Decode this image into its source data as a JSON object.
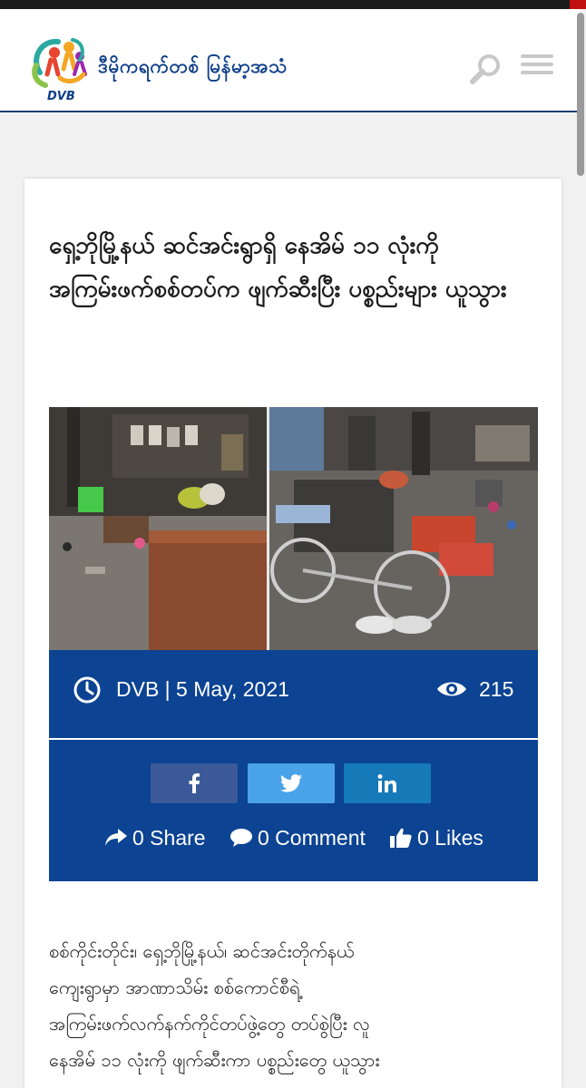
{
  "header": {
    "logo_label": "DVB",
    "site_name": "ဒီမိုကရက်တစ် မြန်မာ့အသံ"
  },
  "article": {
    "title": "ရှေ့ဘိုမြို့နယ် ဆင်အင်းရွာရှိ နေအိမ် ၁၁ လုံးကို အကြမ်းဖက်စစ်တပ်က ဖျက်ဆီးပြီး ပစ္စည်းများ ယူသွား",
    "byline": "DVB | 5 May, 2021",
    "views": "215",
    "share_label": "0 Share",
    "comment_label": "0 Comment",
    "likes_label": "0 Likes",
    "body": "စစ်ကိုင်းတိုင်း၊ ရှေ့ဘိုမြို့နယ်၊ ဆင်အင်းတိုက်နယ်\nကျေးရွာမှာ အာဏာသိမ်း စစ်ကောင်စီရဲ့\nအကြမ်းဖက်လက်နက်ကိုင်တပ်ဖွဲ့တွေ တပ်စွဲပြီး လူ\nနေအိမ် ၁၁ လုံးကို ဖျက်ဆီးကာ ပစ္စည်းတွေ ယူသွား"
  },
  "colors": {
    "meta_bg": "#0c4393",
    "facebook": "#3b5998",
    "twitter": "#4aa3e8",
    "linkedin": "#1679b8",
    "header_rule": "#1d3f6e"
  },
  "icons": [
    "clock-icon",
    "eye-icon",
    "facebook-icon",
    "twitter-icon",
    "linkedin-icon",
    "share-icon",
    "comment-icon",
    "thumbs-up-icon",
    "search-icon",
    "hamburger-menu-icon"
  ]
}
